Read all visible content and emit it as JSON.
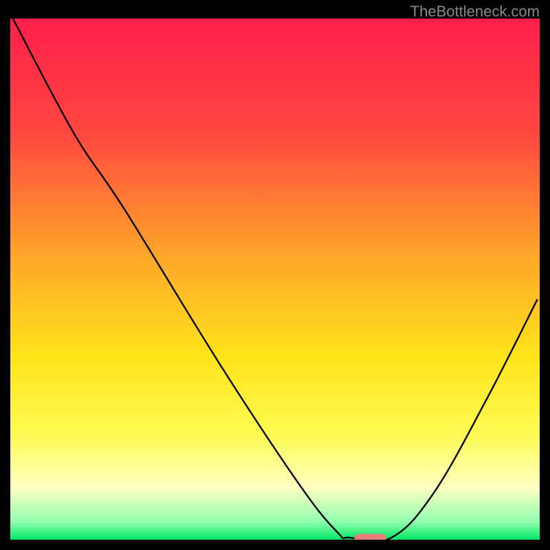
{
  "watermark": {
    "text": "TheBottleneck.com"
  },
  "chart_data": {
    "type": "line",
    "title": "",
    "xlabel": "",
    "ylabel": "",
    "xlim": [
      0,
      100
    ],
    "ylim": [
      0,
      100
    ],
    "gradient_stops": [
      {
        "offset": 0,
        "color": "#ff1f4b"
      },
      {
        "offset": 22,
        "color": "#ff4740"
      },
      {
        "offset": 45,
        "color": "#ffa42a"
      },
      {
        "offset": 65,
        "color": "#ffe41a"
      },
      {
        "offset": 80,
        "color": "#fffb55"
      },
      {
        "offset": 90,
        "color": "#fdffc0"
      },
      {
        "offset": 96.5,
        "color": "#93ffb0"
      },
      {
        "offset": 100,
        "color": "#00e765"
      }
    ],
    "series": [
      {
        "name": "bottleneck-curve",
        "color": "#000000",
        "points": [
          {
            "x": 0.5,
            "y": 100
          },
          {
            "x": 12,
            "y": 78
          },
          {
            "x": 21.5,
            "y": 63.5
          },
          {
            "x": 40,
            "y": 33
          },
          {
            "x": 55,
            "y": 10
          },
          {
            "x": 62,
            "y": 1.2
          },
          {
            "x": 64,
            "y": 0.4
          },
          {
            "x": 72,
            "y": 0.4
          },
          {
            "x": 80,
            "y": 9
          },
          {
            "x": 90,
            "y": 27
          },
          {
            "x": 99.5,
            "y": 46
          }
        ]
      }
    ],
    "marker": {
      "shape": "capsule",
      "x_center": 68,
      "y": 0.2,
      "width": 6,
      "height": 1.8,
      "color": "#e87f7b"
    }
  }
}
